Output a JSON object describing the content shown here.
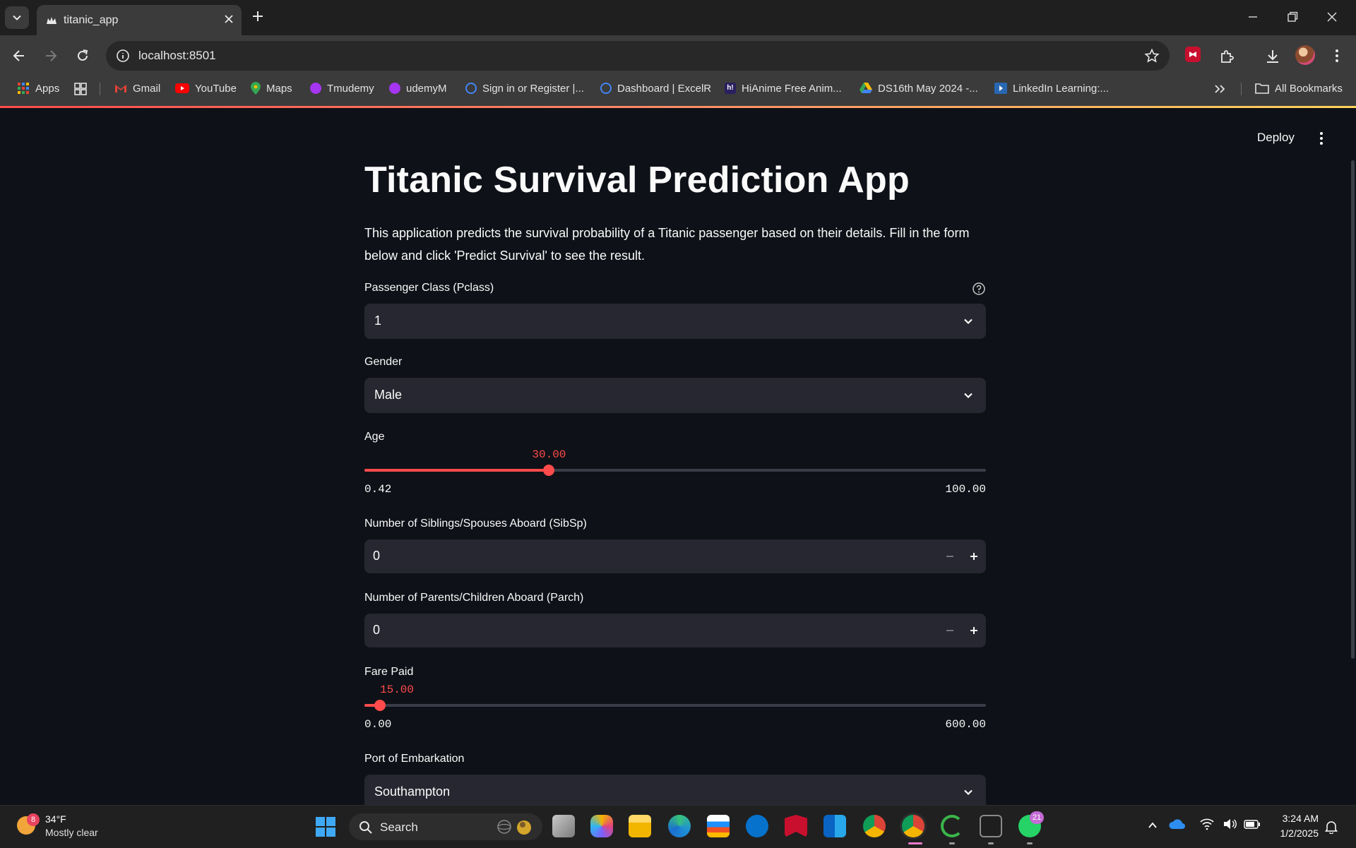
{
  "browser": {
    "tab_title": "titanic_app",
    "url": "localhost:8501",
    "bookmarks": [
      {
        "label": "Apps",
        "color": "#e94235"
      },
      {
        "label": "Gmail",
        "color": "#ea4335"
      },
      {
        "label": "YouTube",
        "color": "#ff0000"
      },
      {
        "label": "Maps",
        "color": "#34a853"
      },
      {
        "label": "Tmudemy",
        "color": "#a435f0"
      },
      {
        "label": "udemyM",
        "color": "#a435f0"
      },
      {
        "label": "Sign in or Register |...",
        "color": "#4285f4"
      },
      {
        "label": "Dashboard | ExcelR",
        "color": "#4285f4"
      },
      {
        "label": "HiAnime Free Anim...",
        "color": "#2a1f5f"
      },
      {
        "label": "DS16th May 2024 -...",
        "color": "#fbbc04"
      },
      {
        "label": "LinkedIn Learning:...",
        "color": "#2867b2"
      }
    ],
    "all_bookmarks": "All Bookmarks"
  },
  "app": {
    "deploy_label": "Deploy",
    "title": "Titanic Survival Prediction App",
    "intro": "This application predicts the survival probability of a Titanic passenger based on their details. Fill in the form below and click 'Predict Survival' to see the result.",
    "accent_color": "#ff4b4b",
    "pclass": {
      "label": "Passenger Class (Pclass)",
      "value": "1"
    },
    "gender": {
      "label": "Gender",
      "value": "Male"
    },
    "age": {
      "label": "Age",
      "value": "30.00",
      "min": "0.42",
      "max": "100.00",
      "value_num": 30.0,
      "min_num": 0.42,
      "max_num": 100.0
    },
    "sibsp": {
      "label": "Number of Siblings/Spouses Aboard (SibSp)",
      "value": "0"
    },
    "parch": {
      "label": "Number of Parents/Children Aboard (Parch)",
      "value": "0"
    },
    "fare": {
      "label": "Fare Paid",
      "value": "15.00",
      "min": "0.00",
      "max": "600.00",
      "value_num": 15.0,
      "min_num": 0.0,
      "max_num": 600.0
    },
    "embarked": {
      "label": "Port of Embarkation",
      "value": "Southampton"
    }
  },
  "taskbar": {
    "weather_badge": "8",
    "temperature": "34°F",
    "weather_desc": "Mostly clear",
    "search_label": "Search",
    "whatsapp_badge": "21",
    "time": "3:24 AM",
    "date": "1/2/2025"
  }
}
